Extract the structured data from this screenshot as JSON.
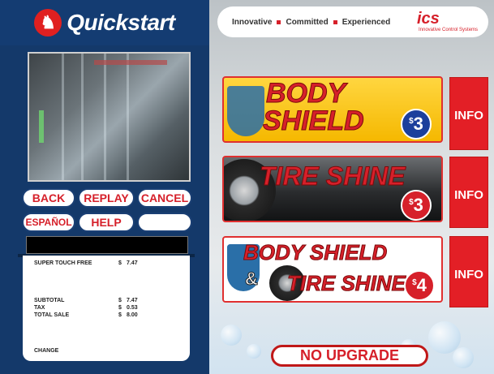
{
  "left": {
    "brand": "Quickstart",
    "buttons": {
      "back": "BACK",
      "replay": "REPLAY",
      "cancel": "CANCEL",
      "espanol": "ESPAÑOL",
      "help": "HELP",
      "blank": ""
    },
    "receipt": {
      "items": [
        {
          "label": "SUPER TOUCH FREE",
          "currency": "$",
          "amount": "7.47"
        }
      ],
      "totals": [
        {
          "label": "SUBTOTAL",
          "currency": "$",
          "amount": "7.47"
        },
        {
          "label": "TAX",
          "currency": "$",
          "amount": "0.53"
        },
        {
          "label": "TOTAL SALE",
          "currency": "$",
          "amount": "8.00"
        }
      ],
      "change_label": "CHANGE"
    }
  },
  "right": {
    "tagline": {
      "word1": "Innovative",
      "word2": "Committed",
      "word3": "Experienced"
    },
    "ics_logo": {
      "mark": "ics",
      "sub": "Innovative Control Systems"
    },
    "products": [
      {
        "title_line1": "BODY",
        "title_line2": "SHIELD",
        "price_symbol": "$",
        "price": "3",
        "info": "INFO"
      },
      {
        "title_line1": "TIRE SHINE",
        "price_symbol": "$",
        "price": "3",
        "info": "INFO"
      },
      {
        "title_line1": "BODY SHIELD",
        "amp": "&",
        "title_line2": "TIRE SHINE",
        "price_symbol": "$",
        "price": "4",
        "info": "INFO"
      }
    ],
    "no_upgrade": "NO UPGRADE"
  },
  "colors": {
    "panel_blue": "#14396a",
    "brand_red": "#d6202a",
    "gold": "#f5b800"
  }
}
